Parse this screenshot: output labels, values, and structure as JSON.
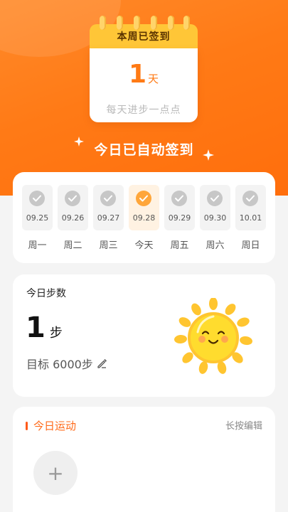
{
  "header": {
    "calendar_title": "本周已签到",
    "signed_count": "1",
    "signed_unit": "天",
    "motto": "每天进步一点点",
    "auto_sign_text": "今日已自动签到",
    "colors": {
      "accent": "#ff7a14",
      "calendar_head": "#ffc637"
    }
  },
  "week": {
    "days": [
      {
        "date": "09.25",
        "label": "周一",
        "checked": true,
        "today": false
      },
      {
        "date": "09.26",
        "label": "周二",
        "checked": true,
        "today": false
      },
      {
        "date": "09.27",
        "label": "周三",
        "checked": true,
        "today": false
      },
      {
        "date": "09.28",
        "label": "今天",
        "checked": true,
        "today": true
      },
      {
        "date": "09.29",
        "label": "周五",
        "checked": true,
        "today": false
      },
      {
        "date": "09.30",
        "label": "周六",
        "checked": true,
        "today": false
      },
      {
        "date": "10.01",
        "label": "周日",
        "checked": true,
        "today": false
      }
    ]
  },
  "steps": {
    "title": "今日步数",
    "value": "1",
    "unit": "步",
    "goal_text": "目标 6000步",
    "icon": "pencil-icon",
    "illustration": "sun-icon"
  },
  "sport": {
    "title": "今日运动",
    "edit_hint": "长按编辑",
    "add_label": "+"
  }
}
